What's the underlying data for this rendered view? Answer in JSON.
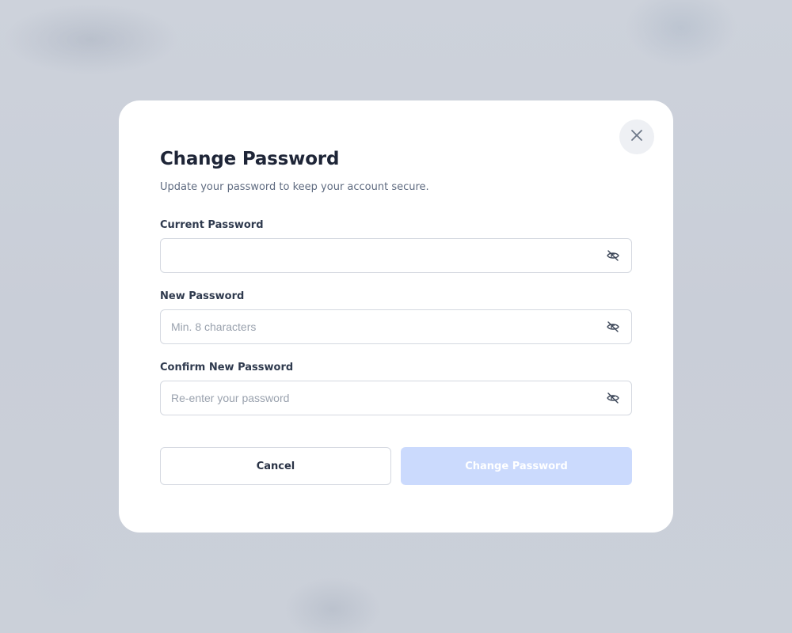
{
  "modal": {
    "title": "Change Password",
    "subtitle": "Update your password to keep your account secure."
  },
  "fields": [
    {
      "label": "Current Password",
      "value": "",
      "placeholder": ""
    },
    {
      "label": "New Password",
      "value": "",
      "placeholder": "Min. 8 characters"
    },
    {
      "label": "Confirm New Password",
      "value": "",
      "placeholder": "Re-enter your password"
    }
  ],
  "actions": {
    "cancel_label": "Cancel",
    "submit_label": "Change Password"
  },
  "icons": {
    "close": "close-icon",
    "visibility": "eye-off-icon"
  },
  "colors": {
    "accent_disabled": "#cbdafd",
    "title": "#1e2537",
    "muted": "#5f6b80"
  }
}
